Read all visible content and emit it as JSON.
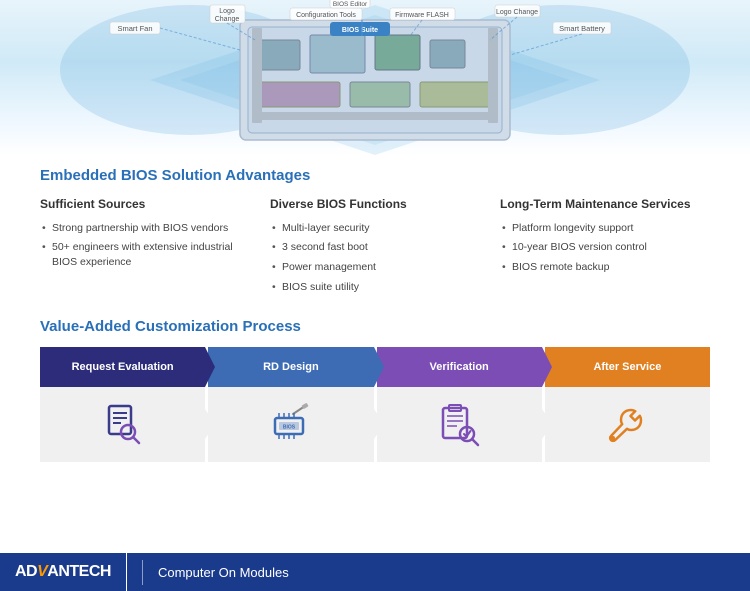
{
  "diagram": {
    "labels": {
      "smart_fan": "Smart Fan",
      "logo_change1": "Logo\nChange",
      "config_tools": "Configuration Tools",
      "bios_suite": "BIOS Suite",
      "firmware_flash": "Firmware FLASH",
      "logo_change2": "Logo Change",
      "smart_battery": "Smart Battery"
    }
  },
  "advantages_section": {
    "title": "Embedded BIOS Solution Advantages",
    "columns": [
      {
        "id": "sufficient-sources",
        "title": "Sufficient Sources",
        "items": [
          "Strong partnership with BIOS vendors",
          "50+ engineers with extensive industrial BIOS experience"
        ]
      },
      {
        "id": "diverse-bios",
        "title": "Diverse BIOS Functions",
        "items": [
          "Multi-layer security",
          "3 second fast boot",
          "Power management",
          "BIOS suite utility"
        ]
      },
      {
        "id": "long-term",
        "title": "Long-Term Maintenance Services",
        "items": [
          "Platform longevity support",
          "10-year BIOS version control",
          "BIOS remote backup"
        ]
      }
    ]
  },
  "process_section": {
    "title": "Value-Added Customization Process",
    "steps": [
      {
        "id": "request-evaluation",
        "label": "Request Evaluation",
        "color_class": "dark-blue",
        "icon": "search-doc"
      },
      {
        "id": "rd-design",
        "label": "RD Design",
        "color_class": "medium-blue",
        "icon": "bios-chip"
      },
      {
        "id": "verification",
        "label": "Verification",
        "color_class": "purple",
        "icon": "magnify-check"
      },
      {
        "id": "after-service",
        "label": "After Service",
        "color_class": "orange",
        "icon": "wrench"
      }
    ]
  },
  "footer": {
    "brand_ad": "AD",
    "brand_van": "ANTECH",
    "brand_full": "ADANTECH",
    "subtitle": "Computer On Modules"
  }
}
